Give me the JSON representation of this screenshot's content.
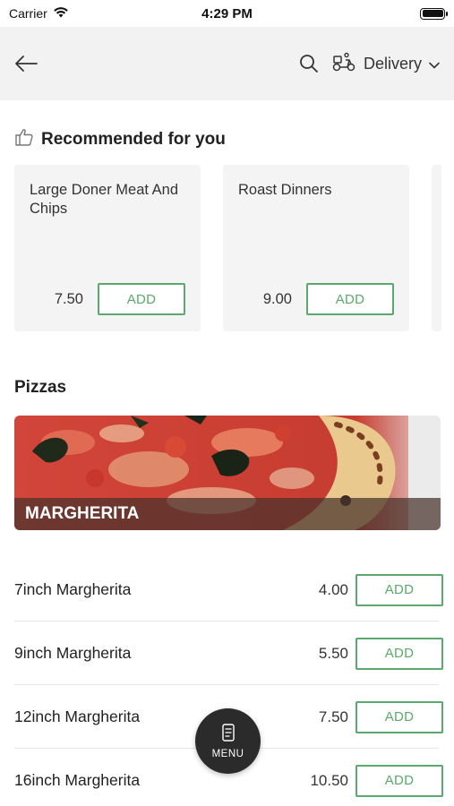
{
  "status_bar": {
    "carrier": "Carrier",
    "time": "4:29 PM",
    "battery_level": 1.0
  },
  "nav": {
    "back_icon": "arrow-left-icon",
    "search_icon": "search-icon",
    "scooter_icon": "delivery-scooter-icon",
    "delivery_label": "Delivery",
    "dropdown_icon": "chevron-down-icon"
  },
  "recommended": {
    "title": "Recommended for you",
    "icon": "thumbs-up-icon",
    "items": [
      {
        "name": "Large Doner Meat And Chips",
        "price": "7.50",
        "add_label": "ADD"
      },
      {
        "name": "Roast Dinners",
        "price": "9.00",
        "add_label": "ADD"
      }
    ]
  },
  "pizzas": {
    "title": "Pizzas",
    "banner_label": "MARGHERITA",
    "items": [
      {
        "name": "7inch Margherita",
        "price": "4.00",
        "add_label": "ADD"
      },
      {
        "name": "9inch Margherita",
        "price": "5.50",
        "add_label": "ADD"
      },
      {
        "name": "12inch Margherita",
        "price": "7.50",
        "add_label": "ADD"
      },
      {
        "name": "16inch Margherita",
        "price": "10.50",
        "add_label": "ADD"
      }
    ]
  },
  "menu_button": {
    "label": "MENU",
    "icon": "menu-book-icon"
  },
  "colors": {
    "accent": "#5aa86c",
    "nav_bg": "#f2f2f2",
    "card_bg": "#f4f4f4",
    "fab_bg": "#2b2b2b"
  }
}
